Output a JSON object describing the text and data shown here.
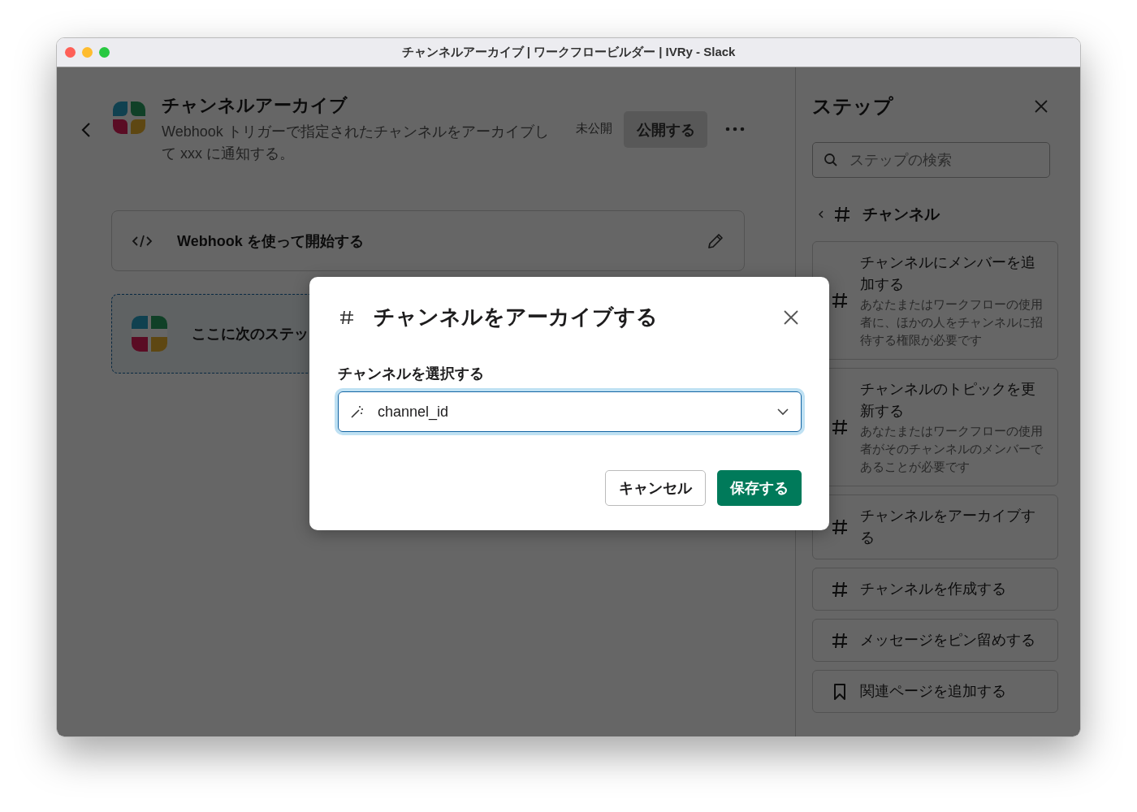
{
  "window": {
    "title": "チャンネルアーカイブ | ワークフロービルダー | IVRy - Slack"
  },
  "header": {
    "title": "チャンネルアーカイブ",
    "description": "Webhook トリガーで指定されたチャンネルをアーカイブして xxx に通知する。",
    "status": "未公開",
    "publish_button": "公開する"
  },
  "trigger": {
    "label": "Webhook を使って開始する"
  },
  "placeholder_step": {
    "label": "ここに次のステッ"
  },
  "steps_panel": {
    "title": "ステップ",
    "search": {
      "placeholder": "ステップの検索"
    },
    "breadcrumb": "チャンネル",
    "items": [
      {
        "kind": "hash",
        "title": "チャンネルにメンバーを追加する",
        "description": "あなたまたはワークフローの使用者に、ほかの人をチャンネルに招待する権限が必要です"
      },
      {
        "kind": "hash",
        "title": "チャンネルのトピックを更新する",
        "description": "あなたまたはワークフローの使用者がそのチャンネルのメンバーであることが必要です"
      },
      {
        "kind": "hash",
        "title": "チャンネルをアーカイブする"
      },
      {
        "kind": "hash",
        "title": "チャンネルを作成する"
      },
      {
        "kind": "hash",
        "title": "メッセージをピン留めする"
      },
      {
        "kind": "bookmark",
        "title": "関連ページを追加する"
      }
    ]
  },
  "modal": {
    "title": "チャンネルをアーカイブする",
    "field_label": "チャンネルを選択する",
    "select": {
      "value": "channel_id",
      "focused": true
    },
    "buttons": [
      {
        "kind": "secondary",
        "label": "キャンセル"
      },
      {
        "kind": "primary",
        "label": "保存する"
      }
    ]
  }
}
